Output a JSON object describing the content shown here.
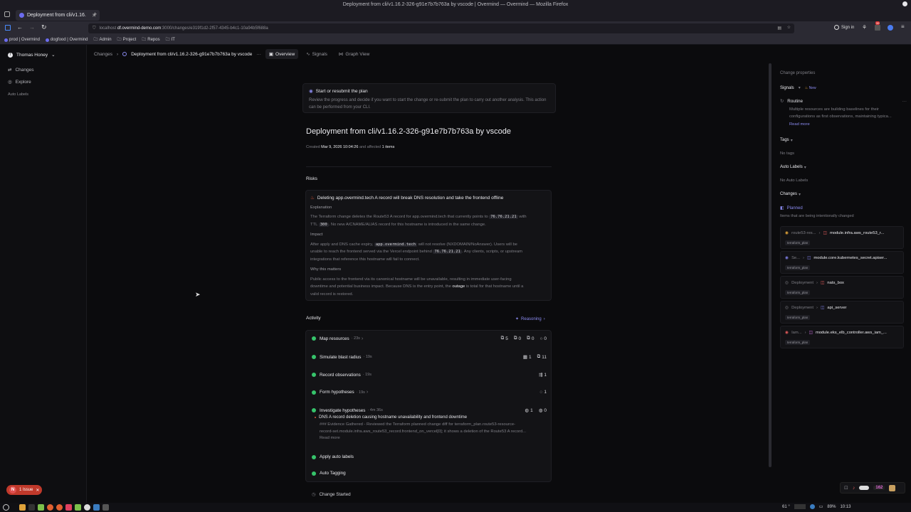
{
  "window": {
    "title": "Deployment from cli/v1.16.2-326-g91e7b7b763a by vscode | Overmind — Overmind — Mozilla Firefox"
  },
  "browser": {
    "tab_title": "Deployment from cli/v1.16.",
    "url_prefix": "localhost",
    "url_domain": "df.overmind-demo.com",
    "url_path": ":3000/changes/e319f1d2-2f57-4345-b4c1-10a94b5f688a",
    "sign_in": "Sign in",
    "badge_count": "39",
    "bookmarks": [
      "prod | Overmind",
      "dogfood | Overmind",
      "Admin",
      "Project",
      "Repos",
      "IT"
    ]
  },
  "sidebar": {
    "user": "Thomas Honey",
    "user_initial": "T",
    "items": [
      "Changes",
      "Explore"
    ],
    "section": "Auto Labels",
    "issue_badge": "1 Issue",
    "issue_logo": "N"
  },
  "topnav": {
    "breadcrumb_root": "Changes",
    "breadcrumb_current": "Deployment from cli/v1.16.2-326-g91e7b7b763a by vscode",
    "more": "···",
    "tabs": [
      "Overview",
      "Signals",
      "Graph View"
    ]
  },
  "notice": {
    "title": "Start or resubmit the plan",
    "body": "Review the progress and decide if you want to start the change or re-submit the plan to carry out another analysis. This action can be performed from your CLI."
  },
  "change": {
    "title": "Deployment from cli/v1.16.2-326-g91e7b7b763a by vscode",
    "created_label": "Created",
    "created_date": "Mar 9, 2026 10:04:26",
    "affected_label": "and affected",
    "affected_count": "1 items"
  },
  "risks": {
    "heading": "Risks",
    "title": "Deleting app.overmind.tech A record will break DNS resolution and take the frontend offline",
    "explanation_h": "Explanation",
    "explanation_a": "The Terraform change deletes the Route53 A record for app.overmind.tech that currently points to",
    "explanation_ip": "76.76.21.21",
    "explanation_b": "with",
    "explanation_c": "TTL",
    "explanation_ttl": "300",
    "explanation_d": ". No new A/CNAME/ALIAS record for this hostname is introduced in the same change.",
    "impact_h": "Impact",
    "impact_a": "After apply and DNS cache expiry,",
    "impact_host": "app.overmind.tech",
    "impact_b": "will not resolve (NXDOMAIN/NoAnswer). Users will be",
    "impact_c": "unable to reach the frontend served via the Vercel endpoint behind",
    "impact_ip": "76.76.21.21",
    "impact_d": ". Any clients, scripts, or upstream",
    "impact_e": "integrations that reference this hostname will fail to connect.",
    "why_h": "Why this matters",
    "why_a": "Public access to the frontend via its canonical hostname will be unavailable, resulting in immediate user-facing",
    "why_b": "downtime and potential business impact. Because DNS is the entry point, the",
    "why_bold": "outage",
    "why_c": "is total for that hostname until a",
    "why_d": "valid record is restored."
  },
  "activity": {
    "heading": "Activity",
    "reasoning": "Reasoning",
    "rows": [
      {
        "label": "Map resources",
        "time": "· 23s",
        "c1": "5",
        "c2": "0",
        "c3": "0",
        "c4": "0"
      },
      {
        "label": "Simulate blast radius",
        "time": "· 19s",
        "c1": "1",
        "c2": "11"
      },
      {
        "label": "Record observations",
        "time": "· 19s",
        "c1": "1"
      },
      {
        "label": "Form hypotheses",
        "time": "· 19s",
        "c1": "1"
      },
      {
        "label": "Investigate hypotheses",
        "time": "· 4m 36s",
        "c1": "1",
        "c2": "0"
      },
      {
        "label": "Apply auto labels"
      },
      {
        "label": "Auto Tagging"
      }
    ],
    "hypothesis_title": "DNS A record deletion causing hostname unavailability and frontend downtime",
    "hypothesis_body_a": "### Evidence Gathered - Reviewed the Terraform planned change diff for terraform_plan.route53-resource-",
    "hypothesis_body_b": "record-set.module.infra.aws_route53_record.frontend_on_vercel[0]; it shows a deletion of the Route53 A record...",
    "read_more": "Read more",
    "change_started": "Change Started"
  },
  "rpanel": {
    "heading": "Change properties",
    "signals_label": "Signals",
    "new_badge": "New",
    "routine_title": "Routine",
    "routine_body_a": "Multiple resources are building baselines for their",
    "routine_body_b": "configurations as first observations, maintaining typica...",
    "read_more": "Read more",
    "tags_label": "Tags",
    "no_tags": "No tags",
    "auto_labels_label": "Auto Labels",
    "no_auto_labels": "No Auto Labels",
    "changes_label": "Changes",
    "planned": "Planned",
    "planned_desc": "Items that are being intentionally changed",
    "changes": [
      {
        "type": "route53-res...",
        "name": "module.infra.aws_route53_r...",
        "chip": "terraform_plan",
        "color": "#e0a33a"
      },
      {
        "type": "Se...",
        "name": "module.core.kubernetes_secret.apiser...",
        "chip": "terraform_plan",
        "color": "#7b7be0"
      },
      {
        "type": "Deployment",
        "name": "nats_box",
        "chip": "terraform_plan",
        "color": "#e05a5a"
      },
      {
        "type": "Deployment",
        "name": "api_server",
        "chip": "terraform_plan",
        "color": "#7b7be0"
      },
      {
        "type": "Iam...",
        "name": "module.eks_elb_controller.aws_iam_...",
        "chip": "terraform_plan",
        "color": "#c46bd8"
      }
    ],
    "counter": "162"
  },
  "taskbar": {
    "temp": "61 °",
    "battery": "89%",
    "time": "10:13"
  }
}
